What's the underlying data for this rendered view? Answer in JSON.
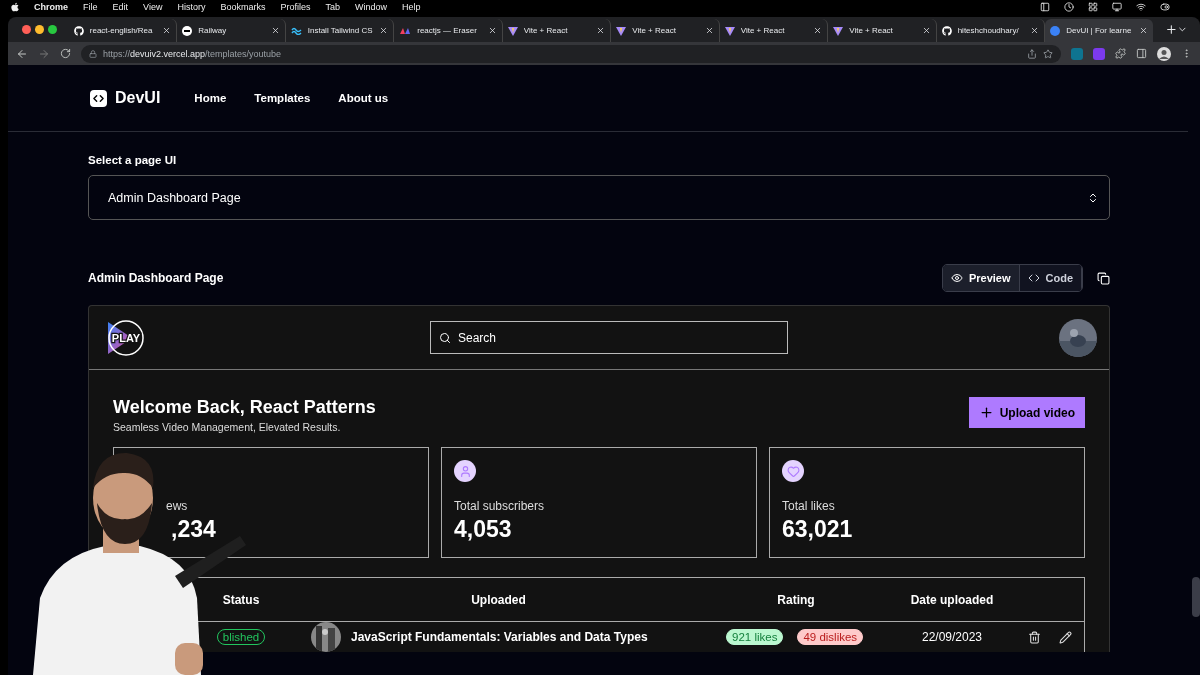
{
  "menu_bar": {
    "app": "Chrome",
    "items": [
      "File",
      "Edit",
      "View",
      "History",
      "Bookmarks",
      "Profiles",
      "Tab",
      "Window",
      "Help"
    ]
  },
  "tabs": [
    {
      "title": "react-english/Rea",
      "kind": "github",
      "selected": false
    },
    {
      "title": "Railway",
      "kind": "railway",
      "selected": false
    },
    {
      "title": "Install Tailwind CS",
      "kind": "tailwind",
      "selected": false
    },
    {
      "title": "reactjs — Eraser",
      "kind": "eraser",
      "selected": false
    },
    {
      "title": "Vite + React",
      "kind": "vite",
      "selected": false
    },
    {
      "title": "Vite + React",
      "kind": "vite",
      "selected": false
    },
    {
      "title": "Vite + React",
      "kind": "vite",
      "selected": false
    },
    {
      "title": "Vite + React",
      "kind": "vite",
      "selected": false
    },
    {
      "title": "hiteshchoudhary/",
      "kind": "github",
      "selected": false
    },
    {
      "title": "DevUI | For learne",
      "kind": "devui",
      "selected": true
    }
  ],
  "address_bar": {
    "url": "https://**devuiv2.vercel.app**/templates/youtube"
  },
  "site_nav": {
    "logo": "DevUI",
    "links": [
      "Home",
      "Templates",
      "About us"
    ]
  },
  "page_select": {
    "label": "Select a page UI",
    "value": "Admin Dashboard Page"
  },
  "preview_header": {
    "title": "Admin Dashboard Page",
    "toggle": [
      {
        "label": "Preview",
        "kind": "eye",
        "selected": true
      },
      {
        "label": "Code",
        "kind": "code",
        "selected": false
      }
    ]
  },
  "dashboard": {
    "logo": "PLAY",
    "search": {
      "placeholder": "Search"
    },
    "welcome": "Welcome Back, React Patterns",
    "subtitle": "Seamless Video Management, Elevated Results.",
    "upload_button": "Upload video",
    "stats": [
      {
        "label": "ews",
        "value": ",234",
        "kind": "covered"
      },
      {
        "label": "Total subscribers",
        "value": "4,053",
        "kind": "user"
      },
      {
        "label": "Total likes",
        "value": "63,021",
        "kind": "heart"
      }
    ],
    "table": {
      "columns": [
        "Status",
        "Uploaded",
        "Rating",
        "Date uploaded"
      ],
      "rows": [
        {
          "status": "blished",
          "title": "JavaScript Fundamentals: Variables and Data Types",
          "likes": "921 likes",
          "dislikes": "49 dislikes",
          "date": "22/09/2023"
        }
      ]
    }
  }
}
